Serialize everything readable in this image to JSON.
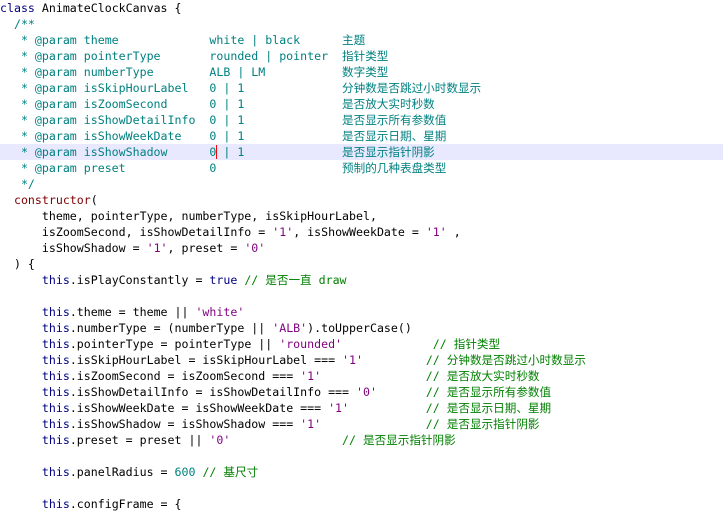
{
  "theme": {
    "background": "#ffffff",
    "current_line_background": "#e8e8ff",
    "caret_color": "#ff0000"
  },
  "current_line": 9,
  "lines": [
    [
      [
        "class ",
        "#00007f"
      ],
      [
        "AnimateClockCanvas {",
        "#000000"
      ]
    ],
    [
      [
        "  /**",
        "#008080"
      ]
    ],
    [
      [
        "   * @param theme             white | black      主题",
        "#008080"
      ]
    ],
    [
      [
        "   * @param pointerType       rounded | pointer  指针类型",
        "#008080"
      ]
    ],
    [
      [
        "   * @param numberType        ALB | LM           数字类型",
        "#008080"
      ]
    ],
    [
      [
        "   * @param isSkipHourLabel   0 | 1              分钟数是否跳过小时数显示",
        "#008080"
      ]
    ],
    [
      [
        "   * @param isZoomSecond      0 | 1              是否放大实时秒数",
        "#008080"
      ]
    ],
    [
      [
        "   * @param isShowDetailInfo  0 | 1              是否显示所有参数值",
        "#008080"
      ]
    ],
    [
      [
        "   * @param isShowWeekDate    0 | 1              是否显示日期、星期",
        "#008080"
      ]
    ],
    [
      [
        "   * @param isShowShadow      0 | 1              是否显示指针阴影",
        "#008080"
      ]
    ],
    [
      [
        "   * @param preset            0                  预制的几种表盘类型",
        "#008080"
      ]
    ],
    [
      [
        "   */",
        "#008080"
      ]
    ],
    [
      [
        "  ",
        "#000000"
      ],
      [
        "constructor",
        "#7f0000"
      ],
      [
        "(",
        "#000000"
      ]
    ],
    [
      [
        "      theme, pointerType, numberType, isSkipHourLabel,",
        "#000000"
      ]
    ],
    [
      [
        "      isZoomSecond, isShowDetailInfo = ",
        "#000000"
      ],
      [
        "'1'",
        "#7f007f"
      ],
      [
        ", isShowWeekDate = ",
        "#000000"
      ],
      [
        "'1'",
        "#7f007f"
      ],
      [
        " ,",
        "#000000"
      ]
    ],
    [
      [
        "      isShowShadow = ",
        "#000000"
      ],
      [
        "'1'",
        "#7f007f"
      ],
      [
        ", preset = ",
        "#000000"
      ],
      [
        "'0'",
        "#7f007f"
      ]
    ],
    [
      [
        "  ) {",
        "#000000"
      ]
    ],
    [
      [
        "      ",
        "#000000"
      ],
      [
        "this",
        "#00007f"
      ],
      [
        ".isPlayConstantly = ",
        "#000000"
      ],
      [
        "true",
        "#00007f"
      ],
      [
        " // 是否一直 draw",
        "#008000"
      ]
    ],
    [
      [
        "",
        "#000000"
      ]
    ],
    [
      [
        "      ",
        "#000000"
      ],
      [
        "this",
        "#00007f"
      ],
      [
        ".theme = theme || ",
        "#000000"
      ],
      [
        "'white'",
        "#7f007f"
      ]
    ],
    [
      [
        "      ",
        "#000000"
      ],
      [
        "this",
        "#00007f"
      ],
      [
        ".numberType = (numberType || ",
        "#000000"
      ],
      [
        "'ALB'",
        "#7f007f"
      ],
      [
        ").toUpperCase()",
        "#000000"
      ]
    ],
    [
      [
        "      ",
        "#000000"
      ],
      [
        "this",
        "#00007f"
      ],
      [
        ".pointerType = pointerType || ",
        "#000000"
      ],
      [
        "'rounded'",
        "#7f007f"
      ],
      [
        "             // 指针类型",
        "#008000"
      ]
    ],
    [
      [
        "      ",
        "#000000"
      ],
      [
        "this",
        "#00007f"
      ],
      [
        ".isSkipHourLabel = isSkipHourLabel === ",
        "#000000"
      ],
      [
        "'1'",
        "#7f007f"
      ],
      [
        "         // 分钟数是否跳过小时数显示",
        "#008000"
      ]
    ],
    [
      [
        "      ",
        "#000000"
      ],
      [
        "this",
        "#00007f"
      ],
      [
        ".isZoomSecond = isZoomSecond === ",
        "#000000"
      ],
      [
        "'1'",
        "#7f007f"
      ],
      [
        "               // 是否放大实时秒数",
        "#008000"
      ]
    ],
    [
      [
        "      ",
        "#000000"
      ],
      [
        "this",
        "#00007f"
      ],
      [
        ".isShowDetailInfo = isShowDetailInfo === ",
        "#000000"
      ],
      [
        "'0'",
        "#7f007f"
      ],
      [
        "       // 是否显示所有参数值",
        "#008000"
      ]
    ],
    [
      [
        "      ",
        "#000000"
      ],
      [
        "this",
        "#00007f"
      ],
      [
        ".isShowWeekDate = isShowWeekDate === ",
        "#000000"
      ],
      [
        "'1'",
        "#7f007f"
      ],
      [
        "           // 是否显示日期、星期",
        "#008000"
      ]
    ],
    [
      [
        "      ",
        "#000000"
      ],
      [
        "this",
        "#00007f"
      ],
      [
        ".isShowShadow = isShowShadow === ",
        "#000000"
      ],
      [
        "'1'",
        "#7f007f"
      ],
      [
        "               // 是否显示指针阴影",
        "#008000"
      ]
    ],
    [
      [
        "      ",
        "#000000"
      ],
      [
        "this",
        "#00007f"
      ],
      [
        ".preset = preset || ",
        "#000000"
      ],
      [
        "'0'",
        "#7f007f"
      ],
      [
        "                // 是否显示指针阴影",
        "#008000"
      ]
    ],
    [
      [
        "",
        "#000000"
      ]
    ],
    [
      [
        "      ",
        "#000000"
      ],
      [
        "this",
        "#00007f"
      ],
      [
        ".panelRadius = ",
        "#000000"
      ],
      [
        "600",
        "#007f7f"
      ],
      [
        " // 基尺寸",
        "#008000"
      ]
    ],
    [
      [
        "",
        "#000000"
      ]
    ],
    [
      [
        "      ",
        "#000000"
      ],
      [
        "this",
        "#00007f"
      ],
      [
        ".configFrame = {",
        "#000000"
      ]
    ]
  ]
}
